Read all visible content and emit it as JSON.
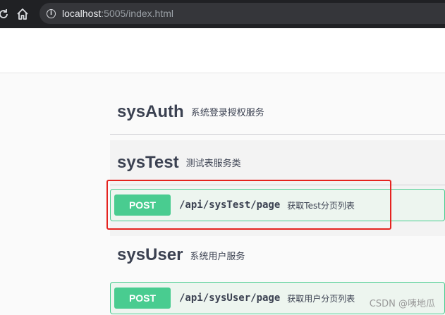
{
  "browser": {
    "url_host": "localhost",
    "url_path": ":5005/index.html"
  },
  "tags": [
    {
      "name": "sysAuth",
      "description": "系统登录授权服务"
    },
    {
      "name": "sysTest",
      "description": "测试表服务类"
    },
    {
      "name": "sysUser",
      "description": "系统用户服务"
    }
  ],
  "operations": [
    {
      "method": "POST",
      "path": "/api/sysTest/page",
      "summary": "获取Test分页列表"
    },
    {
      "method": "POST",
      "path": "/api/sysUser/page",
      "summary": "获取用户分页列表"
    }
  ],
  "colors": {
    "post": "#49cc90",
    "highlight": "#e5231f"
  },
  "watermark": "CSDN @咦地瓜"
}
